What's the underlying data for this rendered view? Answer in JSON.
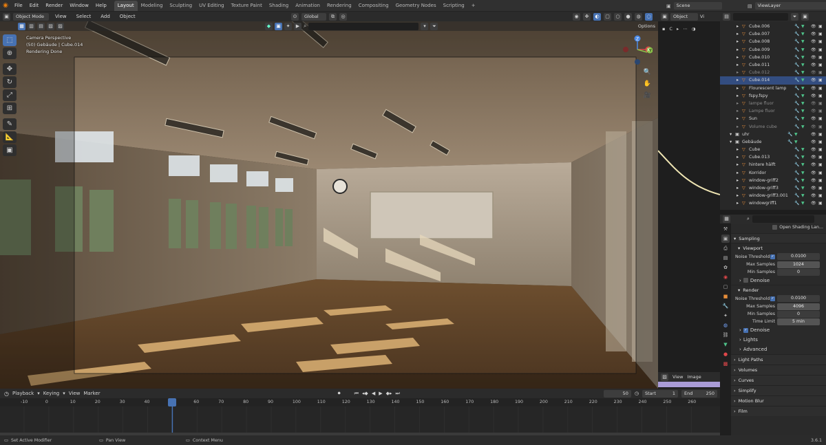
{
  "topbar": {
    "menus": [
      "File",
      "Edit",
      "Render",
      "Window",
      "Help"
    ],
    "workspaces": [
      "Layout",
      "Modeling",
      "Sculpting",
      "UV Editing",
      "Texture Paint",
      "Shading",
      "Animation",
      "Rendering",
      "Compositing",
      "Geometry Nodes",
      "Scripting"
    ],
    "active_workspace": "Layout",
    "add_tab": "+",
    "scene_label": "Scene",
    "viewlayer_label": "ViewLayer"
  },
  "viewport": {
    "mode": "Object Mode",
    "menus": [
      "View",
      "Select",
      "Add",
      "Object"
    ],
    "orientation": "Global",
    "options_label": "Options",
    "overlay_lines": [
      "Camera Perspective",
      "(50) Gebäude | Cube.014",
      "Rendering Done"
    ],
    "gizmo_axes": [
      "X",
      "Y",
      "Z"
    ]
  },
  "graph_header": {
    "mode": "Object",
    "view_label": "Vi",
    "channel": "C"
  },
  "outliner": {
    "rows": [
      {
        "name": "Cube.006",
        "indent": 2,
        "state": "normal"
      },
      {
        "name": "Cube.007",
        "indent": 2,
        "state": "normal"
      },
      {
        "name": "Cube.008",
        "indent": 2,
        "state": "normal"
      },
      {
        "name": "Cube.009",
        "indent": 2,
        "state": "normal"
      },
      {
        "name": "Cube.010",
        "indent": 2,
        "state": "normal"
      },
      {
        "name": "Cube.011",
        "indent": 2,
        "state": "normal"
      },
      {
        "name": "Cube.012",
        "indent": 2,
        "state": "dim"
      },
      {
        "name": "Cube.014",
        "indent": 2,
        "state": "sel"
      },
      {
        "name": "Flourescent lamp",
        "indent": 2,
        "state": "normal"
      },
      {
        "name": "fspy.fspy",
        "indent": 2,
        "state": "normal"
      },
      {
        "name": "lampe fluor",
        "indent": 2,
        "state": "dim"
      },
      {
        "name": "Lampe fluor",
        "indent": 2,
        "state": "dim"
      },
      {
        "name": "Sun",
        "indent": 2,
        "state": "normal"
      },
      {
        "name": "Volume cube",
        "indent": 2,
        "state": "dim"
      },
      {
        "name": "uhr",
        "indent": 1,
        "state": "normal"
      },
      {
        "name": "Gebäude",
        "indent": 1,
        "state": "normal"
      },
      {
        "name": "Cube",
        "indent": 2,
        "state": "normal"
      },
      {
        "name": "Cube.013",
        "indent": 2,
        "state": "normal"
      },
      {
        "name": "hintere hälft",
        "indent": 2,
        "state": "normal"
      },
      {
        "name": "Korridor",
        "indent": 2,
        "state": "normal"
      },
      {
        "name": "window-griff2",
        "indent": 2,
        "state": "normal"
      },
      {
        "name": "window-griff3",
        "indent": 2,
        "state": "normal"
      },
      {
        "name": "window-griff3.001",
        "indent": 2,
        "state": "normal"
      },
      {
        "name": "windowgriff1",
        "indent": 2,
        "state": "normal"
      }
    ]
  },
  "properties": {
    "shading_button": "Open Shading Lan...",
    "sampling": "Sampling",
    "viewport_panel": "Viewport",
    "render_panel": "Render",
    "noise_threshold_label": "Noise Threshold",
    "viewport_noise_threshold": "0.0100",
    "max_samples_label": "Max Samples",
    "viewport_max_samples": "1024",
    "min_samples_label": "Min Samples",
    "viewport_min_samples": "0",
    "denoise_label": "Denoise",
    "render_noise_threshold": "0.0100",
    "render_max_samples": "4096",
    "render_min_samples": "0",
    "time_limit_label": "Time Limit",
    "render_time_limit": "5 min",
    "lights_label": "Lights",
    "advanced_label": "Advanced",
    "collapsed_panels": [
      "Light Paths",
      "Volumes",
      "Curves",
      "Simplify",
      "Motion Blur",
      "Film"
    ]
  },
  "image_header": {
    "view": "View",
    "image": "Image"
  },
  "timeline": {
    "menus": [
      "Playback",
      "Keying",
      "View",
      "Marker"
    ],
    "current_frame": "50",
    "start_label": "Start",
    "start_value": "1",
    "end_label": "End",
    "end_value": "250",
    "ticks": [
      "-10",
      "0",
      "10",
      "20",
      "30",
      "40",
      "50",
      "60",
      "70",
      "80",
      "90",
      "100",
      "110",
      "120",
      "130",
      "140",
      "150",
      "160",
      "170",
      "180",
      "190",
      "200",
      "210",
      "220",
      "230",
      "240",
      "250",
      "260"
    ]
  },
  "status": {
    "items": [
      "Set Active Modifier",
      "Pan View",
      "Context Menu"
    ],
    "version": "3.6.1"
  },
  "colors": {
    "accent": "#4772b3",
    "selected_row": "#334d80",
    "mesh_orange": "#e58d3a",
    "modifier_blue": "#78a8ff",
    "material_green": "#4fc38a",
    "curve_yellow": "#f0e6b4",
    "axis_x": "#e0474a",
    "axis_y": "#8bc34a",
    "axis_z": "#4d8be6"
  }
}
